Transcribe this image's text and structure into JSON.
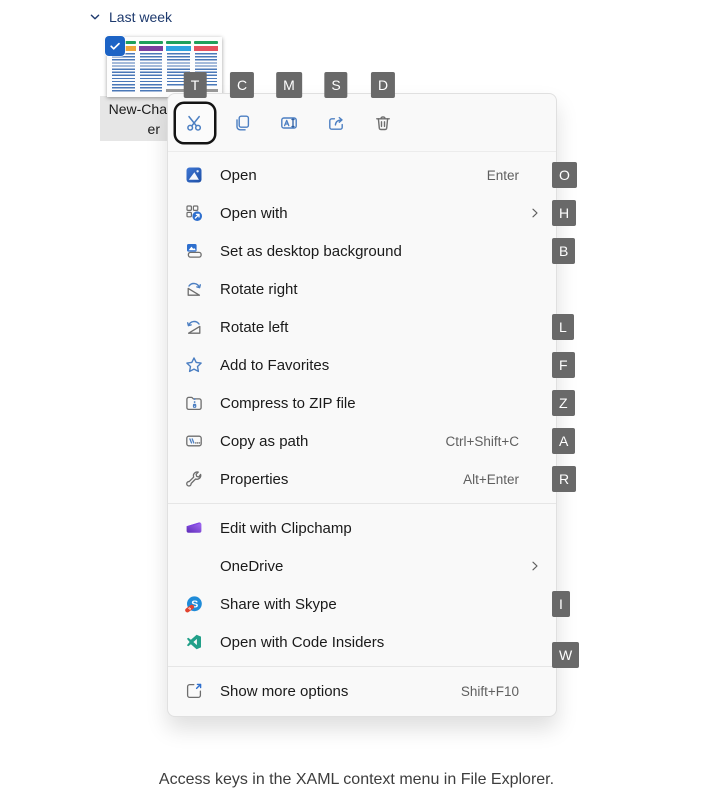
{
  "group_header": {
    "label": "Last week"
  },
  "file_item": {
    "name_line1": "New-Cha",
    "name_line2": "er",
    "selected": true,
    "thumbnail_columns": [
      {
        "header": "#1fa05c",
        "bar": "#f0a63a",
        "footer": false
      },
      {
        "header": "#1fa05c",
        "bar": "#7b3fa0",
        "footer": false
      },
      {
        "header": "#1fa05c",
        "bar": "#2ea3e0",
        "footer": true
      },
      {
        "header": "#1fa05c",
        "bar": "#e5505e",
        "footer": true
      }
    ]
  },
  "context_menu": {
    "toolbar": [
      {
        "icon": "cut-icon",
        "keytip": "T",
        "focused": true
      },
      {
        "icon": "copy-icon",
        "keytip": "C",
        "focused": false
      },
      {
        "icon": "rename-icon",
        "keytip": "M",
        "focused": false
      },
      {
        "icon": "share-icon",
        "keytip": "S",
        "focused": false
      },
      {
        "icon": "delete-icon",
        "keytip": "D",
        "focused": false
      }
    ],
    "items": [
      {
        "label": "Open",
        "icon": "photos-icon",
        "shortcut": "Enter",
        "keytip": "O"
      },
      {
        "label": "Open with",
        "icon": "open-with-icon",
        "submenu": true,
        "keytip": "H"
      },
      {
        "label": "Set as desktop background",
        "icon": "desktop-background-icon",
        "keytip": "B"
      },
      {
        "label": "Rotate right",
        "icon": "rotate-right-icon"
      },
      {
        "label": "Rotate left",
        "icon": "rotate-left-icon",
        "keytip": "L"
      },
      {
        "label": "Add to Favorites",
        "icon": "favorites-icon",
        "keytip": "F"
      },
      {
        "label": "Compress to ZIP file",
        "icon": "zip-icon",
        "keytip": "Z"
      },
      {
        "label": "Copy as path",
        "icon": "copy-path-icon",
        "shortcut": "Ctrl+Shift+C",
        "keytip": "A"
      },
      {
        "label": "Properties",
        "icon": "properties-icon",
        "shortcut": "Alt+Enter",
        "keytip": "R"
      },
      {
        "type": "separator"
      },
      {
        "label": "Edit with Clipchamp",
        "icon": "clipchamp-icon"
      },
      {
        "label": "OneDrive",
        "icon": null,
        "submenu": true
      },
      {
        "label": "Share with Skype",
        "icon": "skype-icon",
        "keytip": "I"
      },
      {
        "label": "Open with Code Insiders",
        "icon": "code-insiders-icon",
        "keytip": "W"
      },
      {
        "type": "separator"
      },
      {
        "label": "Show more options",
        "icon": "show-more-icon",
        "shortcut": "Shift+F10"
      }
    ]
  },
  "caption": "Access keys in the XAML context menu in File Explorer.",
  "colors": {
    "accent_blue": "#4c7fc2",
    "icon_gray": "#6e6e6e",
    "keytip_bg": "#696969",
    "header_navy": "#1e3a6e",
    "menu_bg": "#f9f9f9",
    "checkbox_blue": "#1c63c5"
  }
}
